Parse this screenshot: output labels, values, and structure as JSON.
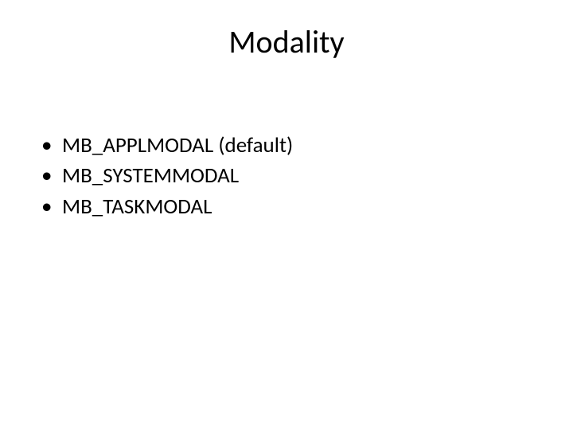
{
  "slide": {
    "title": "Modality",
    "bullets": [
      "MB_APPLMODAL (default)",
      "MB_SYSTEMMODAL",
      "MB_TASKMODAL"
    ]
  }
}
